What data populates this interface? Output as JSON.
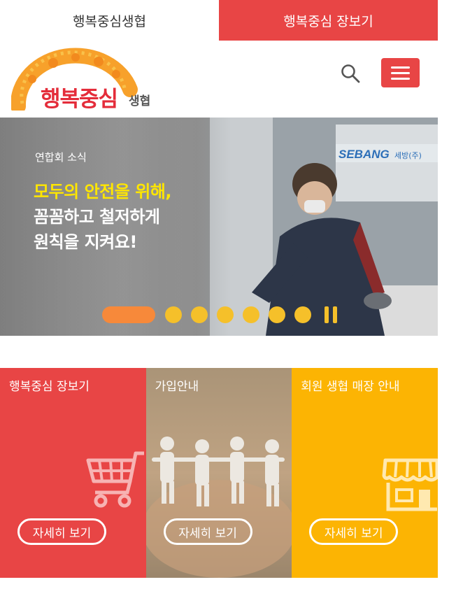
{
  "top_tabs": {
    "coop_label": "행복중심생협",
    "shop_label": "행복중심 장보기"
  },
  "header": {
    "logo_main": "행복중심",
    "logo_sub": "생협",
    "icons": [
      "search-icon",
      "hamburger-menu-icon"
    ]
  },
  "banner": {
    "category": "연합회 소식",
    "headline_1": "모두의 안전을 위해,",
    "headline_2": "꼼꼼하고 철저하게",
    "headline_3": "원칙을 지켜요!",
    "photo_sign_text": "SEBANG 세방(주)",
    "slide_count": 7,
    "active_slide": 1
  },
  "cards": [
    {
      "title": "행복중심 장보기",
      "button": "자세히 보기",
      "icon": "shopping-cart-icon"
    },
    {
      "title": "가입안내",
      "button": "자세히 보기",
      "icon": "paper-people-image"
    },
    {
      "title": "회원 생협 매장 안내",
      "button": "자세히 보기",
      "icon": "store-icon"
    }
  ],
  "colors": {
    "brand_red": "#e84545",
    "accent_orange": "#f7893a",
    "accent_yellow": "#f5c02a",
    "card_yellow": "#fcb403"
  }
}
